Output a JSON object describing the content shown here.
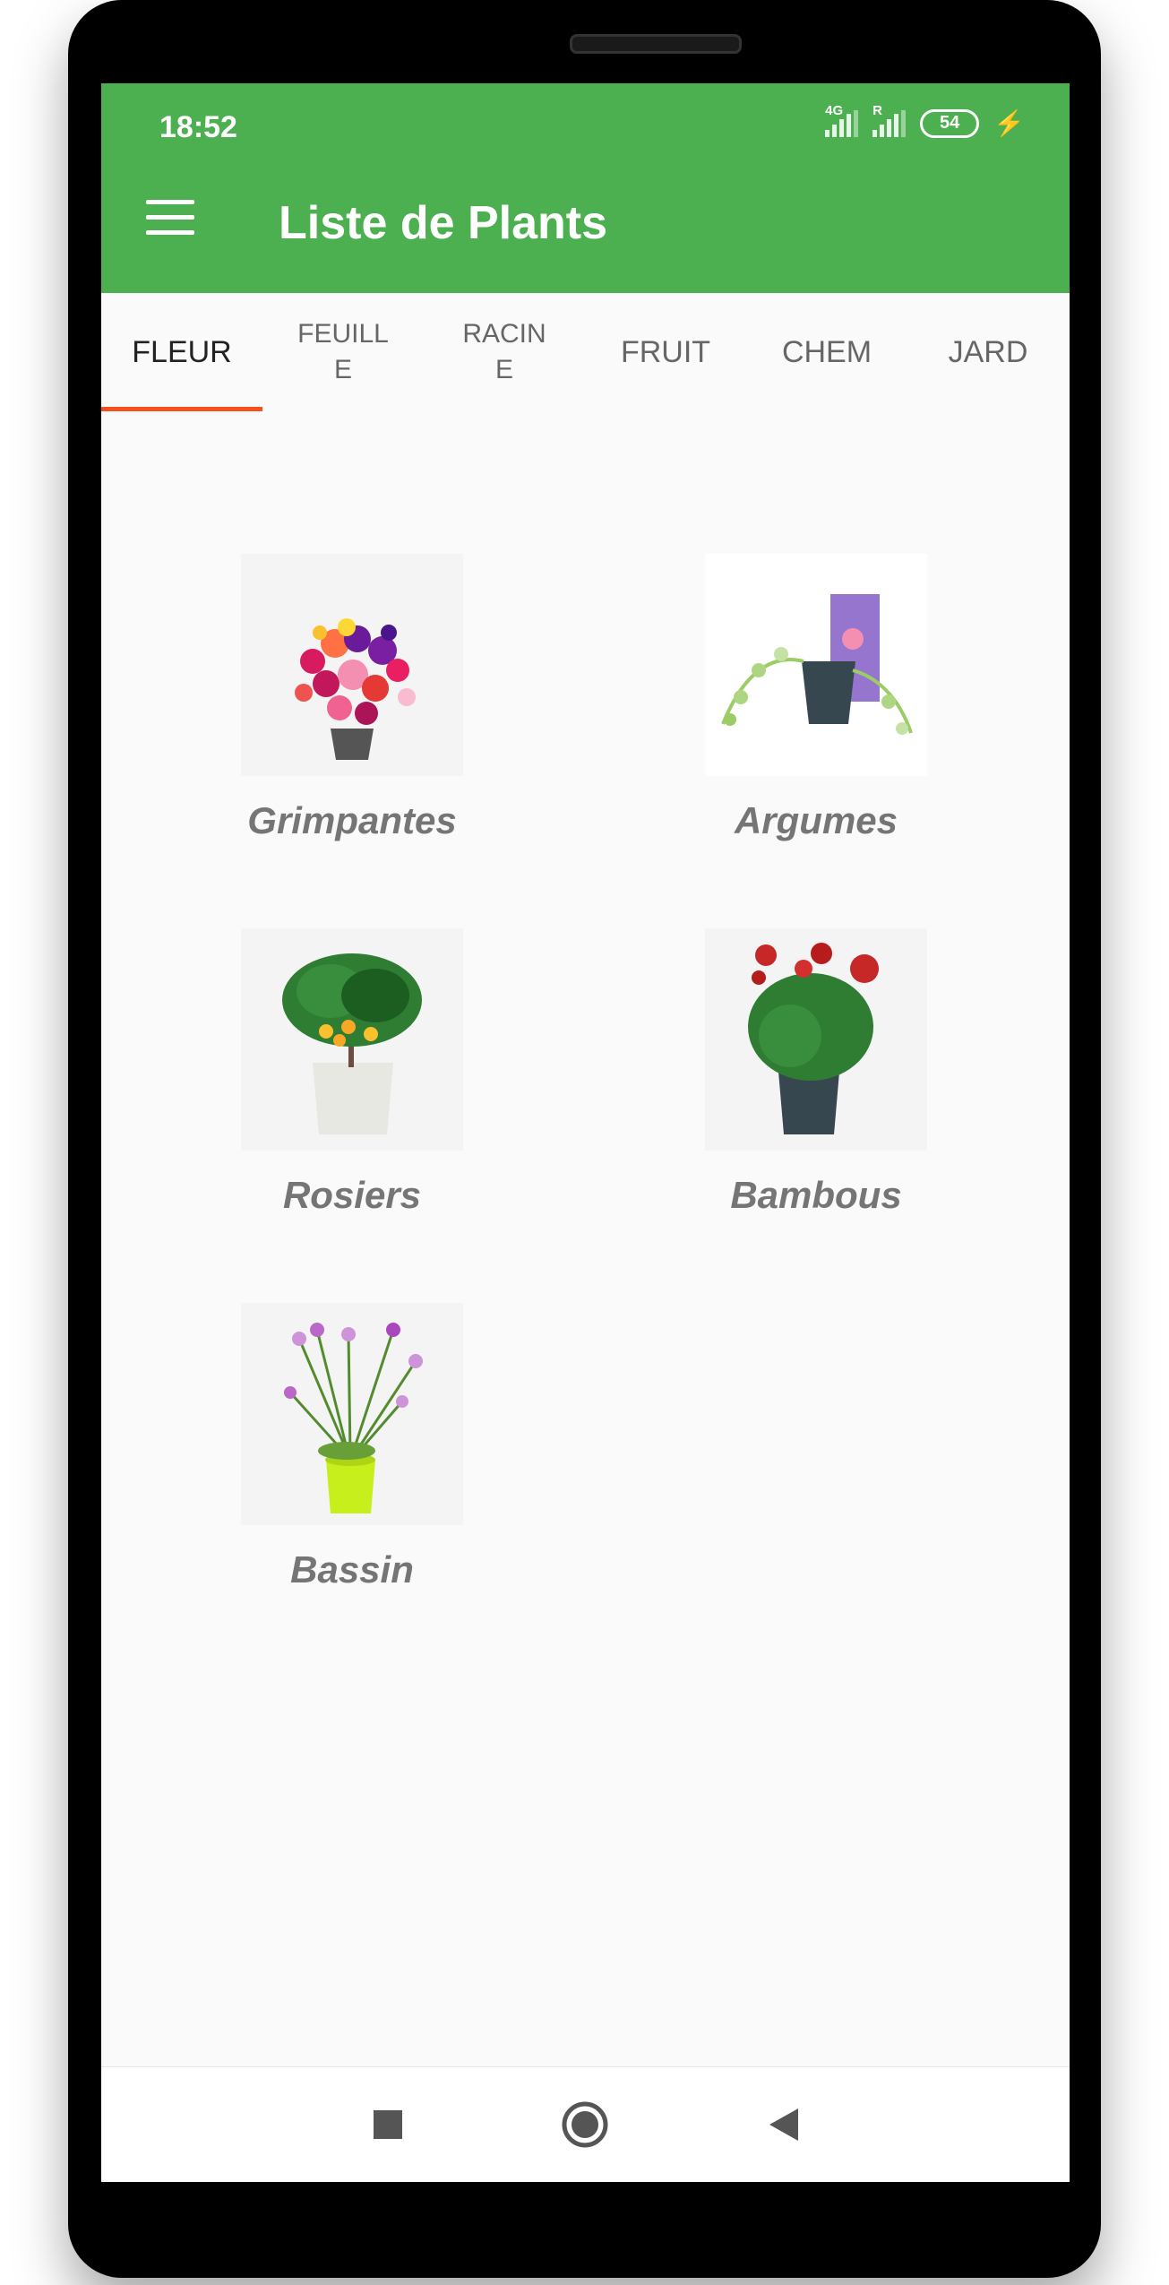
{
  "status_bar": {
    "time": "18:52",
    "network_label": "4G",
    "roaming_label": "R",
    "battery_level": "54"
  },
  "app_bar": {
    "title": "Liste de Plants"
  },
  "tabs": [
    {
      "label": "FLEUR",
      "active": true
    },
    {
      "label": "FEUILL\nE",
      "active": false
    },
    {
      "label": "RACIN\nE",
      "active": false
    },
    {
      "label": "FRUIT",
      "active": false
    },
    {
      "label": "CHEM",
      "active": false
    },
    {
      "label": "JARD",
      "active": false
    }
  ],
  "plants": [
    {
      "name": "Grimpantes",
      "icon": "flower-bouquet-pot-image"
    },
    {
      "name": "Argumes",
      "icon": "hanging-plant-pot-image"
    },
    {
      "name": "Rosiers",
      "icon": "citrus-tree-pot-image"
    },
    {
      "name": "Bambous",
      "icon": "red-rose-bush-pot-image"
    },
    {
      "name": "Bassin",
      "icon": "pink-daisy-yellow-pot-image"
    }
  ],
  "colors": {
    "app_bar": "#4caf50",
    "tab_indicator": "#f4511e",
    "background": "#fafafa",
    "label_text": "#757575"
  }
}
